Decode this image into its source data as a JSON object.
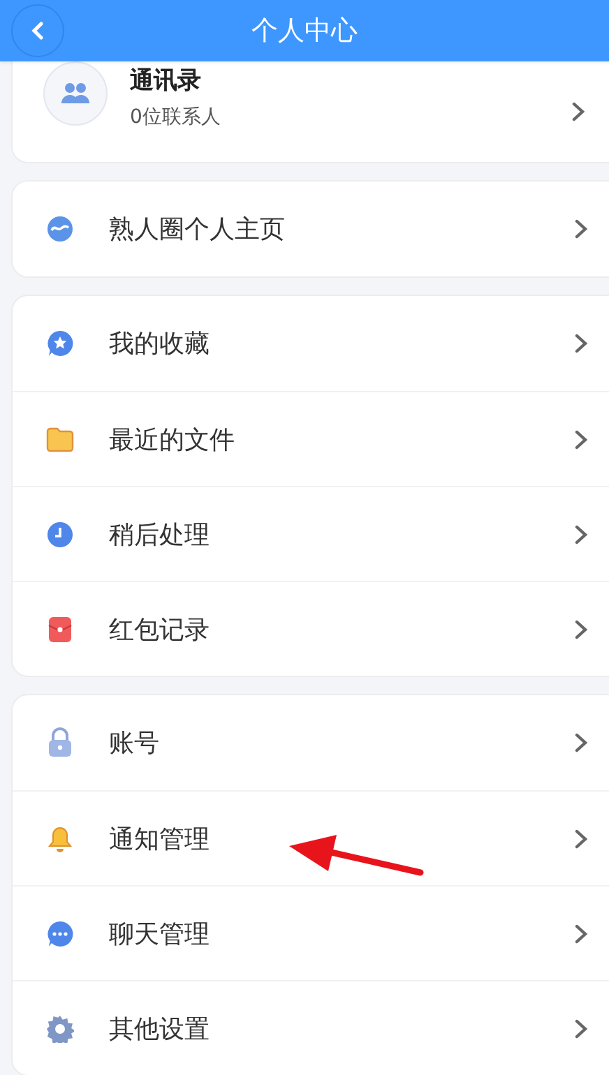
{
  "header": {
    "title": "个人中心"
  },
  "contacts": {
    "title": "通讯录",
    "subtitle": "0位联系人"
  },
  "groups": [
    {
      "items": [
        {
          "label": "熟人圈个人主页"
        }
      ]
    },
    {
      "items": [
        {
          "label": "我的收藏"
        },
        {
          "label": "最近的文件"
        },
        {
          "label": "稍后处理"
        },
        {
          "label": "红包记录"
        }
      ]
    },
    {
      "items": [
        {
          "label": "账号"
        },
        {
          "label": "通知管理"
        },
        {
          "label": "聊天管理"
        },
        {
          "label": "其他设置"
        }
      ]
    }
  ]
}
